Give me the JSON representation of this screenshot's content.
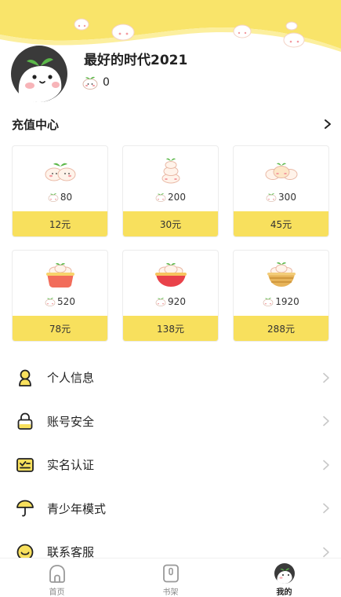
{
  "profile": {
    "username": "最好的时代2021",
    "coin_count": "0"
  },
  "recharge": {
    "title": "充值中心",
    "packs": [
      {
        "coins": "80",
        "price": "12元",
        "art": "bun-pair-icon"
      },
      {
        "coins": "200",
        "price": "30元",
        "art": "bun-stack-icon"
      },
      {
        "coins": "300",
        "price": "45元",
        "art": "bun-group-icon"
      },
      {
        "coins": "520",
        "price": "78元",
        "art": "bun-basket-icon"
      },
      {
        "coins": "920",
        "price": "138元",
        "art": "bun-bowl-icon"
      },
      {
        "coins": "1920",
        "price": "288元",
        "art": "bun-steamer-icon"
      }
    ]
  },
  "menu": {
    "items": [
      {
        "label": "个人信息",
        "icon": "person-icon"
      },
      {
        "label": "账号安全",
        "icon": "lock-icon"
      },
      {
        "label": "实名认证",
        "icon": "id-card-icon"
      },
      {
        "label": "青少年模式",
        "icon": "umbrella-icon"
      },
      {
        "label": "联系客服",
        "icon": "smile-chat-icon"
      }
    ]
  },
  "tabbar": {
    "tabs": [
      {
        "label": "首页",
        "icon": "home-icon",
        "active": false
      },
      {
        "label": "书架",
        "icon": "bookshelf-icon",
        "active": false
      },
      {
        "label": "我的",
        "icon": "avatar-icon",
        "active": true
      }
    ]
  },
  "colors": {
    "brand_yellow": "#f8e05d",
    "header_yellow": "#f9e46a",
    "text": "#222222",
    "chevron": "#c8c8c8"
  }
}
